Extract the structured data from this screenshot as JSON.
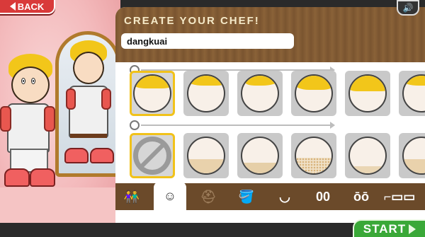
{
  "nav": {
    "back_label": "BACK",
    "start_label": "START",
    "sound_icon": "speaker-icon"
  },
  "editor": {
    "title": "CREATE YOUR CHEF!",
    "name_value": "dangkuai"
  },
  "rows": [
    {
      "name": "hair",
      "icon": "hair-row-icon",
      "option_count": 6,
      "selected_index": 0
    },
    {
      "name": "facial-hair",
      "icon": "mustache-row-icon",
      "option_count": 6,
      "selected_index": 0
    }
  ],
  "tabs": [
    {
      "name": "tab-body",
      "icon": "people-icon",
      "glyph": "👫"
    },
    {
      "name": "tab-head",
      "icon": "head-icon",
      "glyph": "☺",
      "active": true
    },
    {
      "name": "tab-hat",
      "icon": "hat-icon",
      "glyph": "⛑",
      "muted": true
    },
    {
      "name": "tab-skin",
      "icon": "paint-can-icon",
      "glyph": "🪣"
    },
    {
      "name": "tab-mouth",
      "icon": "mouth-icon",
      "glyph": "◡"
    },
    {
      "name": "tab-eyes",
      "icon": "eyes-icon",
      "glyph": "00"
    },
    {
      "name": "tab-eyebrows",
      "icon": "eyebrows-icon",
      "glyph": "ōō"
    },
    {
      "name": "tab-glasses",
      "icon": "glasses-icon",
      "glyph": "⌐▭▭"
    }
  ],
  "colors": {
    "hair": "#f2c61a",
    "accent_green": "#3aa838",
    "back_red": "#d93a3a",
    "panel_wood": "#7a5530"
  }
}
